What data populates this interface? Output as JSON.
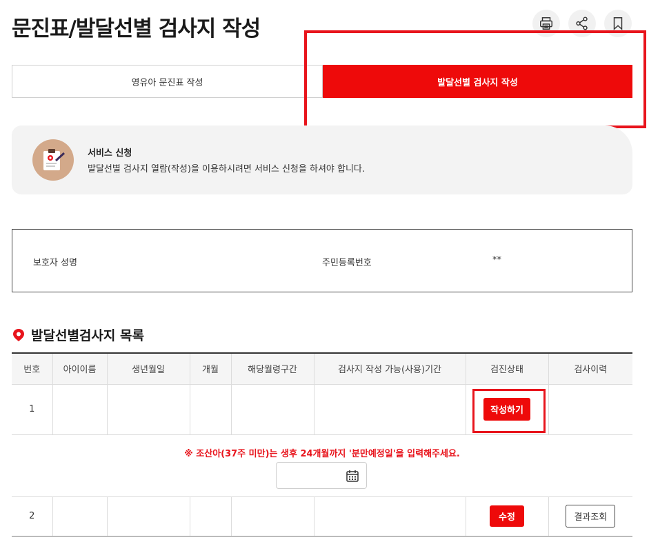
{
  "page": {
    "title": "문진표/발달선별 검사지 작성"
  },
  "header_actions": [
    {
      "name": "print-icon"
    },
    {
      "name": "share-icon"
    },
    {
      "name": "bookmark-icon"
    }
  ],
  "tabs": [
    {
      "label": "영유아 문진표 작성",
      "active": false
    },
    {
      "label": "발달선별 검사지 작성",
      "active": true
    }
  ],
  "notice": {
    "icon": "clipboard-icon",
    "title": "서비스 신청",
    "description": "발달선별 검사지 열람(작성)을 이용하시려면 서비스 신청을 하셔야 합니다."
  },
  "guardian": {
    "name_label": "보호자 성명",
    "name_value": "",
    "rrn_label": "주민등록번호",
    "rrn_value": "**"
  },
  "list": {
    "title": "발달선별검사지 목록",
    "columns": [
      "번호",
      "아이이름",
      "생년월일",
      "개월",
      "해당월령구간",
      "검사지 작성 가능(사용)기간",
      "검진상태",
      "검사이력"
    ],
    "rows": [
      {
        "no": "1",
        "status_button": "작성하기",
        "history_button": ""
      },
      {
        "no": "2",
        "status_button": "수정",
        "history_button": "결과조회"
      }
    ],
    "premature_note": "※ 조산아(37주 미만)는 생후 24개월까지 '분만예정일'을 입력해주세요.",
    "due_date_value": ""
  },
  "colors": {
    "accent": "#ee0a0a",
    "highlight_outline": "#e8141c",
    "notice_bg": "#f3f3f3",
    "notice_icon_bg": "#d3a98a"
  }
}
